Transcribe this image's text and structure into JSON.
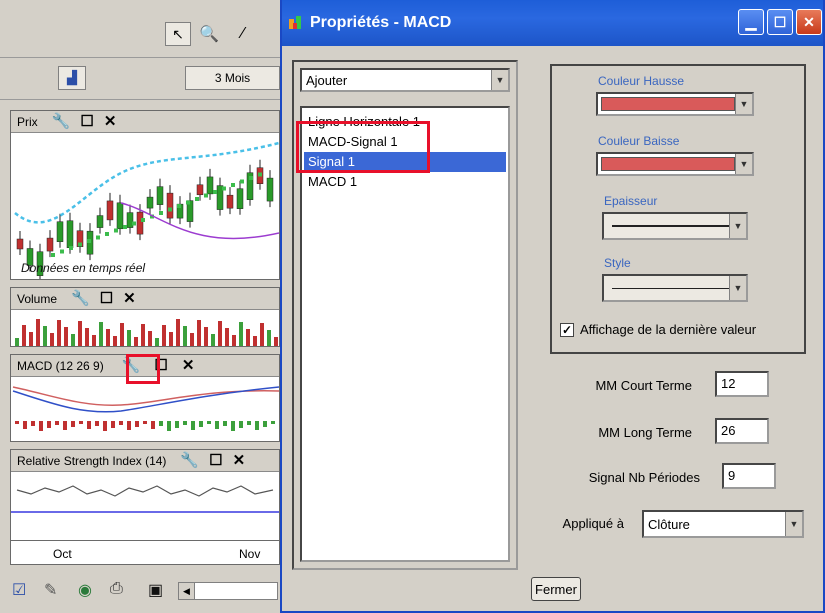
{
  "app": {
    "period_button": "3 Mois",
    "panels": {
      "price": {
        "title": "Prix",
        "overlay_text": "Données en temps réel"
      },
      "volume": {
        "title": "Volume"
      },
      "macd": {
        "title": "MACD (12 26 9)"
      },
      "rsi": {
        "title": "Relative Strength Index (14)"
      }
    },
    "x_axis_labels": [
      "Oct",
      "Nov"
    ],
    "icons": {
      "pointer": "cursor-arrow-icon",
      "zoom": "magnifier-icon",
      "draw": "line-draw-icon",
      "chart": "chart-icon",
      "wrench": "wrench-icon",
      "maximize": "maximize-icon",
      "close": "close-icon"
    }
  },
  "dialog": {
    "title": "Propriétés - MACD",
    "add_combo": "Ajouter",
    "list_items": [
      "Ligne Horizontale 1",
      "MACD-Signal 1",
      "Signal 1",
      "MACD 1"
    ],
    "selected_index": 2,
    "color_up_label": "Couleur Hausse",
    "color_down_label": "Couleur Baisse",
    "thickness_label": "Epaisseur",
    "style_label": "Style",
    "show_last_value_label": "Affichage de la dernière valeur",
    "show_last_value_checked": true,
    "short_term_label": "MM Court Terme",
    "short_term_value": "12",
    "long_term_label": "MM Long Terme",
    "long_term_value": "26",
    "signal_label": "Signal Nb Périodes",
    "signal_value": "9",
    "applied_label": "Appliqué à",
    "applied_value": "Clôture",
    "close_button": "Fermer",
    "colors": {
      "up": "#d95a5a",
      "down": "#d95a5a",
      "titlebar": "#1e5ed8",
      "selection": "#3b68d6",
      "highlight": "#e8102a"
    }
  }
}
